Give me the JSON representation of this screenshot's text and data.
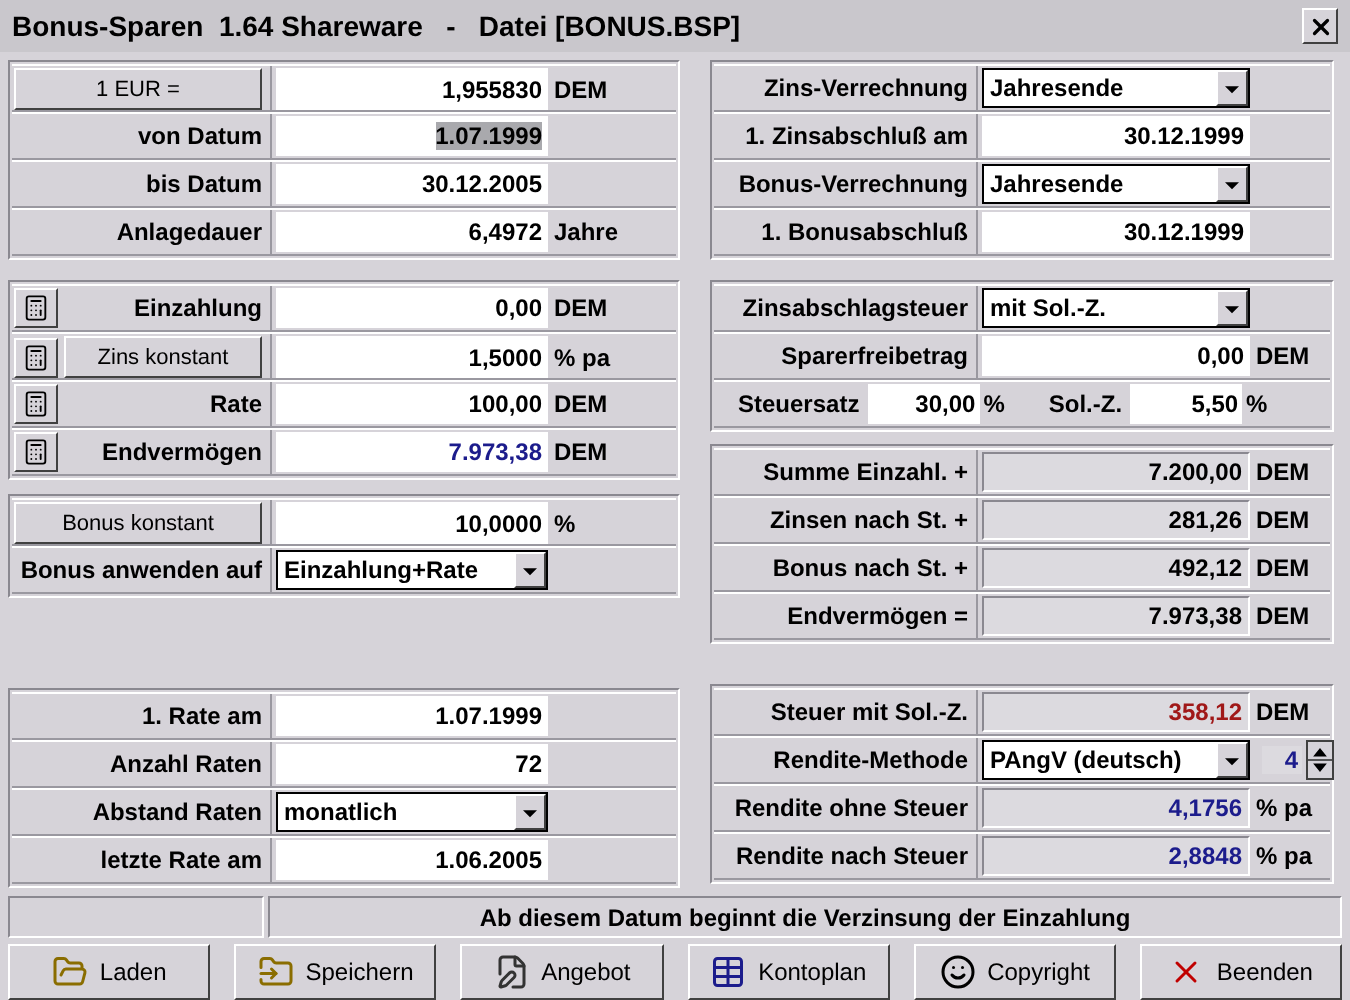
{
  "window": {
    "title": "Bonus-Sparen  1.64 Shareware   -   Datei [BONUS.BSP]"
  },
  "left_groups": [
    {
      "rows": [
        {
          "kind": "button",
          "label": "1 EUR =",
          "value": "1,955830",
          "unit": "DEM"
        },
        {
          "kind": "field",
          "label": "von Datum",
          "value": "1.07.1999",
          "text_selected": true
        },
        {
          "kind": "field",
          "label": "bis Datum",
          "value": "30.12.2005"
        },
        {
          "kind": "field",
          "label": "Anlagedauer",
          "value": "6,4972",
          "unit": "Jahre"
        }
      ]
    },
    {
      "rows": [
        {
          "kind": "field",
          "calc_button": true,
          "label": "Einzahlung",
          "value": "0,00",
          "unit": "DEM"
        },
        {
          "kind": "button",
          "calc_button": true,
          "label": "Zins konstant",
          "value": "1,5000",
          "unit": "% pa"
        },
        {
          "kind": "field",
          "calc_button": true,
          "label": "Rate",
          "value": "100,00",
          "unit": "DEM"
        },
        {
          "kind": "field",
          "calc_button": true,
          "label": "Endvermögen",
          "value": "7.973,38",
          "unit": "DEM",
          "color": "#1c1c8c"
        }
      ]
    },
    {
      "rows": [
        {
          "kind": "button",
          "label": "Bonus konstant",
          "value": "10,0000",
          "unit": "%"
        },
        {
          "kind": "dropdown",
          "label": "Bonus anwenden auf",
          "value": "Einzahlung+Rate"
        }
      ]
    },
    {
      "rows": [
        {
          "kind": "field",
          "label": "1. Rate am",
          "value": "1.07.1999"
        },
        {
          "kind": "field",
          "label": "Anzahl Raten",
          "value": "72"
        },
        {
          "kind": "dropdown",
          "label": "Abstand Raten",
          "value": "monatlich"
        },
        {
          "kind": "field",
          "label": "letzte Rate am",
          "value": "1.06.2005"
        }
      ]
    }
  ],
  "right_groups": [
    {
      "rows": [
        {
          "kind": "dropdown",
          "label": "Zins-Verrechnung",
          "value": "Jahresende"
        },
        {
          "kind": "field",
          "label": "1. Zinsabschluß am",
          "value": "30.12.1999"
        },
        {
          "kind": "dropdown",
          "label": "Bonus-Verrechnung",
          "value": "Jahresende"
        },
        {
          "kind": "field",
          "label": "1. Bonusabschluß",
          "value": "30.12.1999"
        }
      ]
    },
    {
      "rows": [
        {
          "kind": "dropdown",
          "label": "Zinsabschlagsteuer",
          "value": "mit Sol.-Z."
        },
        {
          "kind": "field",
          "label": "Sparerfreibetrag",
          "value": "0,00",
          "unit": "DEM"
        },
        {
          "kind": "pair",
          "parts": [
            {
              "label": "Steuersatz",
              "value": "30,00",
              "unit": "%"
            },
            {
              "label": "Sol.-Z.",
              "value": "5,50",
              "unit": "%"
            }
          ]
        }
      ]
    },
    {
      "rows": [
        {
          "kind": "readonly",
          "label": "Summe Einzahl. +",
          "value": "7.200,00",
          "unit": "DEM"
        },
        {
          "kind": "readonly",
          "label": "Zinsen nach St. +",
          "value": "281,26",
          "unit": "DEM"
        },
        {
          "kind": "readonly",
          "label": "Bonus nach St. +",
          "value": "492,12",
          "unit": "DEM"
        },
        {
          "kind": "readonly",
          "label": "Endvermögen =",
          "value": "7.973,38",
          "unit": "DEM"
        }
      ]
    },
    {
      "rows": [
        {
          "kind": "readonly",
          "label": "Steuer mit Sol.-Z.",
          "value": "358,12",
          "unit": "DEM",
          "color": "#a01818"
        },
        {
          "kind": "dropdown",
          "label": "Rendite-Methode",
          "value": "PAngV (deutsch)",
          "spinner": "4"
        },
        {
          "kind": "readonly",
          "label": "Rendite ohne Steuer",
          "value": "4,1756",
          "unit": "% pa",
          "color": "#1c1c8c"
        },
        {
          "kind": "readonly",
          "label": "Rendite nach Steuer",
          "value": "2,8848",
          "unit": "% pa",
          "color": "#1c1c8c"
        }
      ]
    }
  ],
  "status_bar": {
    "message": "Ab diesem Datum beginnt die Verzinsung der Einzahlung"
  },
  "buttons": [
    {
      "label": "Laden"
    },
    {
      "label": "Speichern"
    },
    {
      "label": "Angebot"
    },
    {
      "label": "Kontoplan"
    },
    {
      "label": "Copyright"
    },
    {
      "label": "Beenden"
    }
  ]
}
